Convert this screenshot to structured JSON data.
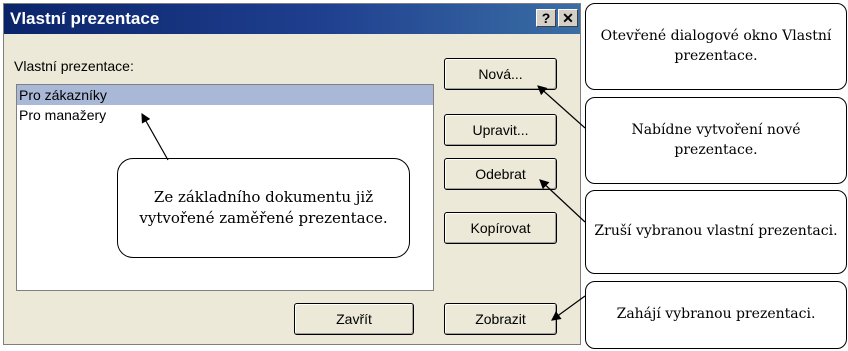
{
  "dialog": {
    "title": "Vlastní prezentace",
    "help_glyph": "?",
    "close_glyph": "✕",
    "list_label": "Vlastní prezentace:",
    "items": [
      "Pro zákazníky",
      "Pro manažery"
    ],
    "selected_index": 0,
    "buttons": {
      "new": "Nová...",
      "edit": "Upravit...",
      "remove": "Odebrat",
      "copy": "Kopírovat",
      "close": "Zavřít",
      "show": "Zobrazit"
    }
  },
  "callouts": {
    "dialog_open": "Otevřené dialogové okno Vlastní prezentace.",
    "new_offer": "Nabídne vytvoření nové prezentace.",
    "remove_info": "Zruší vybranou vlastní prezentaci.",
    "show_info": "Zahájí vybranou prezentaci.",
    "list_info": "Ze základního dokumentu již vytvořené zaměřené prezentace."
  },
  "colors": {
    "title_bar": "#0a246a",
    "selection": "#a9b8d6",
    "dialog_bg": "#ece9d8"
  }
}
